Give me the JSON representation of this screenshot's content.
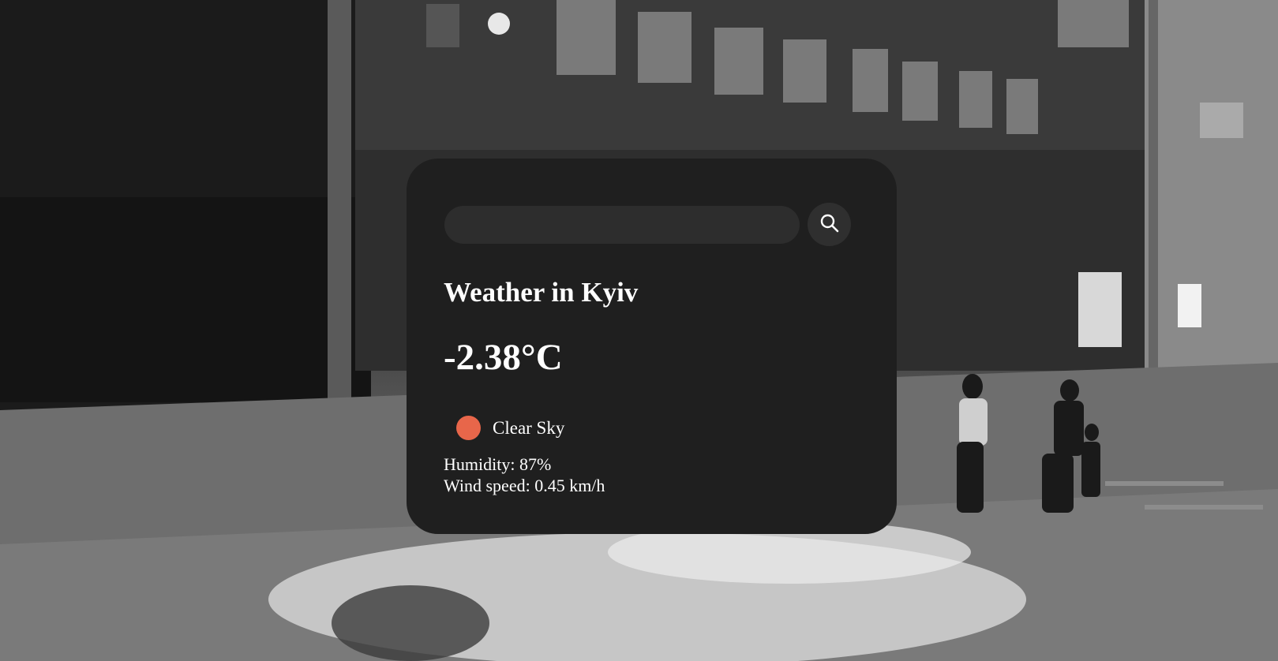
{
  "background": {
    "description_icon": "street-photo-background"
  },
  "search": {
    "value": "",
    "placeholder": "",
    "icon": "search-icon"
  },
  "weather": {
    "city_title": "Weather in Kyiv",
    "temperature": "-2.38°C",
    "condition": "Clear Sky",
    "condition_icon": "sun-icon",
    "humidity": "Humidity: 87%",
    "wind": "Wind speed: 0.45 km/h"
  },
  "colors": {
    "card": "#1f1f1f",
    "input": "#2d2d2d",
    "accent": "#e8664a",
    "text": "#ffffff"
  }
}
